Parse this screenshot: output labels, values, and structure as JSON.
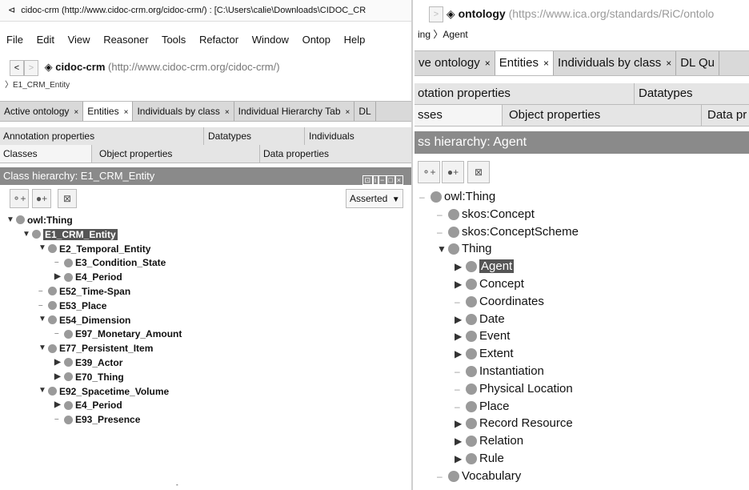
{
  "left": {
    "title": "cidoc-crm (http://www.cidoc-crm.org/cidoc-crm/)  : [C:\\Users\\calie\\Downloads\\CIDOC_CR",
    "menu": [
      "File",
      "Edit",
      "View",
      "Reasoner",
      "Tools",
      "Refactor",
      "Window",
      "Ontop",
      "Help"
    ],
    "nav_back": "<",
    "nav_fwd": ">",
    "ontology_name": "cidoc-crm",
    "ontology_iri": "(http://www.cidoc-crm.org/cidoc-crm/)",
    "breadcrumb": "E1_CRM_Entity",
    "tabs": [
      "Active ontology",
      "Entities",
      "Individuals by class",
      "Individual Hierarchy Tab",
      "DL"
    ],
    "tab_close": "×",
    "subtabs_row1": [
      "Annotation properties",
      "Datatypes",
      "Individuals"
    ],
    "subtabs_row2": [
      "Classes",
      "Object properties",
      "Data properties"
    ],
    "hierarchy_title": "Class hierarchy: E1_CRM_Entity",
    "asserted_label": "Asserted",
    "tree": [
      {
        "label": "owl:Thing",
        "exp": "▼"
      },
      {
        "label": "E1_CRM_Entity",
        "exp": "▼",
        "selected": true
      },
      {
        "label": "E2_Temporal_Entity",
        "exp": "▼"
      },
      {
        "label": "E3_Condition_State",
        "exp": ""
      },
      {
        "label": "E4_Period",
        "exp": "▶"
      },
      {
        "label": "E52_Time-Span",
        "exp": ""
      },
      {
        "label": "E53_Place",
        "exp": ""
      },
      {
        "label": "E54_Dimension",
        "exp": "▼"
      },
      {
        "label": "E97_Monetary_Amount",
        "exp": ""
      },
      {
        "label": "E77_Persistent_Item",
        "exp": "▼"
      },
      {
        "label": "E39_Actor",
        "exp": "▶"
      },
      {
        "label": "E70_Thing",
        "exp": "▶"
      },
      {
        "label": "E92_Spacetime_Volume",
        "exp": "▼"
      },
      {
        "label": "E4_Period",
        "exp": "▶"
      },
      {
        "label": "E93_Presence",
        "exp": ""
      }
    ]
  },
  "right": {
    "title_name": "ontology",
    "title_iri": "(https://www.ica.org/standards/RiC/ontolo",
    "breadcrumb": "ing 〉Agent",
    "tabs": [
      "ve ontology",
      "Entities",
      "Individuals by class",
      "DL Qu"
    ],
    "tab_close": "×",
    "subtabs_row1": [
      "otation properties",
      "Datatypes"
    ],
    "subtabs_row2": [
      "sses",
      "Object properties",
      "Data pr"
    ],
    "hierarchy_title": "ss hierarchy: Agent",
    "tree": [
      {
        "label": "owl:Thing",
        "exp": ""
      },
      {
        "label": "skos:Concept",
        "exp": ""
      },
      {
        "label": "skos:ConceptScheme",
        "exp": ""
      },
      {
        "label": "Thing",
        "exp": "▼"
      },
      {
        "label": "Agent",
        "exp": "▶",
        "selected": true
      },
      {
        "label": "Concept",
        "exp": "▶"
      },
      {
        "label": "Coordinates",
        "exp": ""
      },
      {
        "label": "Date",
        "exp": "▶"
      },
      {
        "label": "Event",
        "exp": "▶"
      },
      {
        "label": "Extent",
        "exp": "▶"
      },
      {
        "label": "Instantiation",
        "exp": ""
      },
      {
        "label": "Physical Location",
        "exp": ""
      },
      {
        "label": "Place",
        "exp": ""
      },
      {
        "label": "Record Resource",
        "exp": "▶"
      },
      {
        "label": "Relation",
        "exp": "▶"
      },
      {
        "label": "Rule",
        "exp": "▶"
      },
      {
        "label": "Vocabulary",
        "exp": ""
      }
    ]
  }
}
